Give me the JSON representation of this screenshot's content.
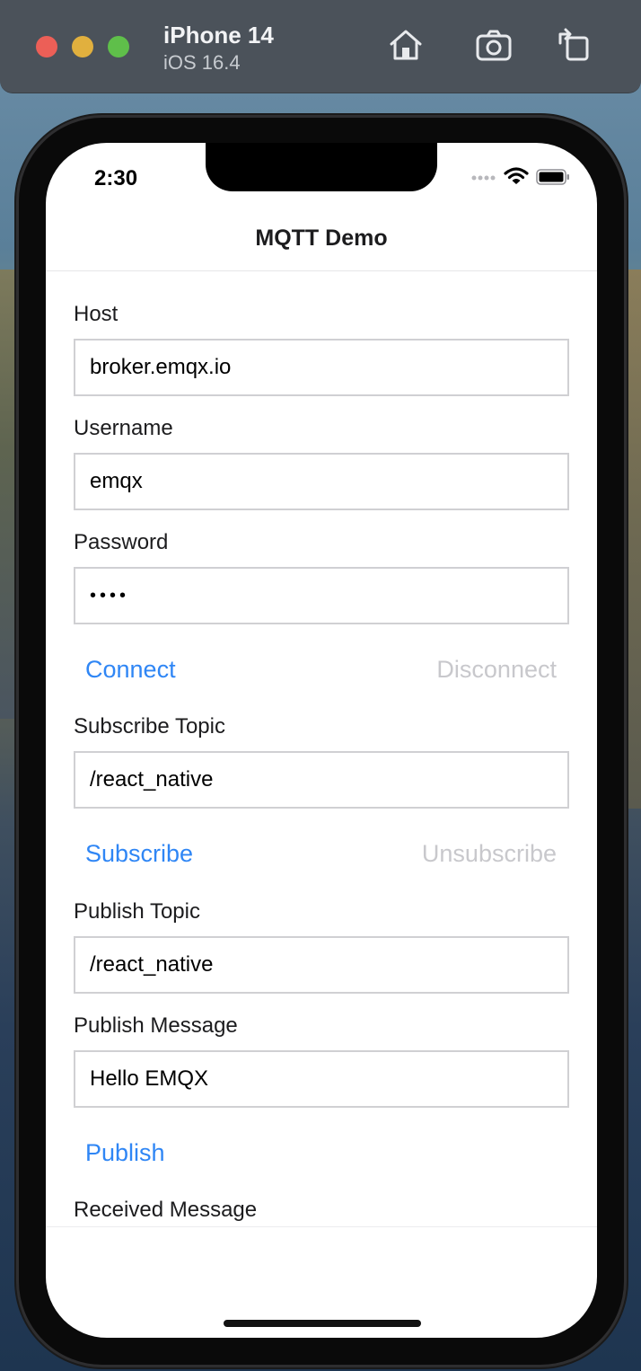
{
  "simulator": {
    "device_name": "iPhone 14",
    "os_version": "iOS 16.4",
    "icons": [
      "home-icon",
      "screenshot-icon",
      "rotate-icon"
    ]
  },
  "status_bar": {
    "time": "2:30"
  },
  "app": {
    "title": "MQTT Demo",
    "accent_color": "#2f86f5",
    "disabled_color": "#c8c8cc",
    "host": {
      "label": "Host",
      "value": "broker.emqx.io"
    },
    "username": {
      "label": "Username",
      "value": "emqx"
    },
    "password": {
      "label": "Password",
      "value": "••••"
    },
    "connection_buttons": {
      "connect": "Connect",
      "disconnect": "Disconnect"
    },
    "subscribe_topic": {
      "label": "Subscribe Topic",
      "value": "/react_native"
    },
    "subscription_buttons": {
      "subscribe": "Subscribe",
      "unsubscribe": "Unsubscribe"
    },
    "publish_topic": {
      "label": "Publish Topic",
      "value": "/react_native"
    },
    "publish_message": {
      "label": "Publish Message",
      "value": "Hello EMQX"
    },
    "publish_button": "Publish",
    "received_message": {
      "label": "Received Message"
    }
  }
}
